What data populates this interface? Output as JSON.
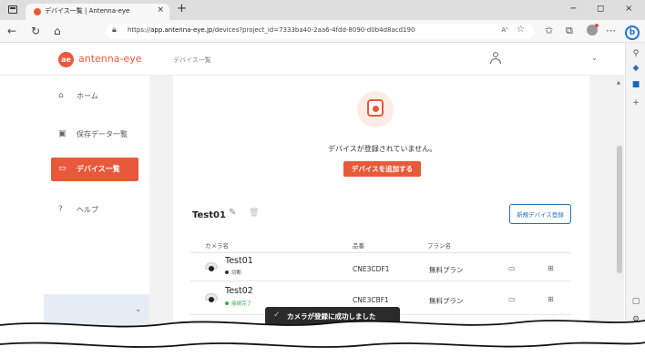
{
  "browser": {
    "tab_title": "デバイス一覧 | Antenna-eye",
    "tab_close": "×",
    "new_tab": "+",
    "url_prefix": "https://",
    "url_host": "app.antenna-eye.jp",
    "url_path": "/devices?project_id=7333ba40-2aa6-4fdd-8090-d0b4d8acd190",
    "read_aloud": "Aʰ",
    "minimize": "−",
    "restore": "◻",
    "close": "×",
    "bing_letter": "b"
  },
  "header": {
    "logo_mark": "ae",
    "logo_text": "antenna-eye",
    "breadcrumb": "デバイス一覧",
    "chevron": "⌄"
  },
  "sidebar": {
    "items": [
      {
        "label": "ホーム",
        "icon": "home-icon"
      },
      {
        "label": "保存データ一覧",
        "icon": "image-icon"
      },
      {
        "label": "デバイス一覧",
        "icon": "camera-icon",
        "active": true
      },
      {
        "label": "ヘルプ",
        "icon": "help-icon"
      }
    ],
    "collapse_chevron": "⌄"
  },
  "empty_state": {
    "message": "デバイスが登録されていません。",
    "add_button": "デバイスを追加する"
  },
  "project": {
    "title": "Test01",
    "new_device_button": "新規デバイス登録"
  },
  "table": {
    "headers": [
      "カメラ名",
      "品番",
      "プラン名"
    ],
    "rows": [
      {
        "name": "Test01",
        "status": "切断",
        "status_color": "#333333",
        "model": "CNE3CDF1",
        "plan": "無料プラン"
      },
      {
        "name": "Test02",
        "status": "接続完了",
        "status_color": "#3aa757",
        "model": "CNE3CBF1",
        "plan": "無料プラン"
      }
    ]
  },
  "toast": {
    "message": "カメラが登録に成功しました"
  },
  "colors": {
    "accent": "#e8593b",
    "link_blue": "#2e6fb3",
    "sidebar_bottom": "#e6edf6"
  }
}
